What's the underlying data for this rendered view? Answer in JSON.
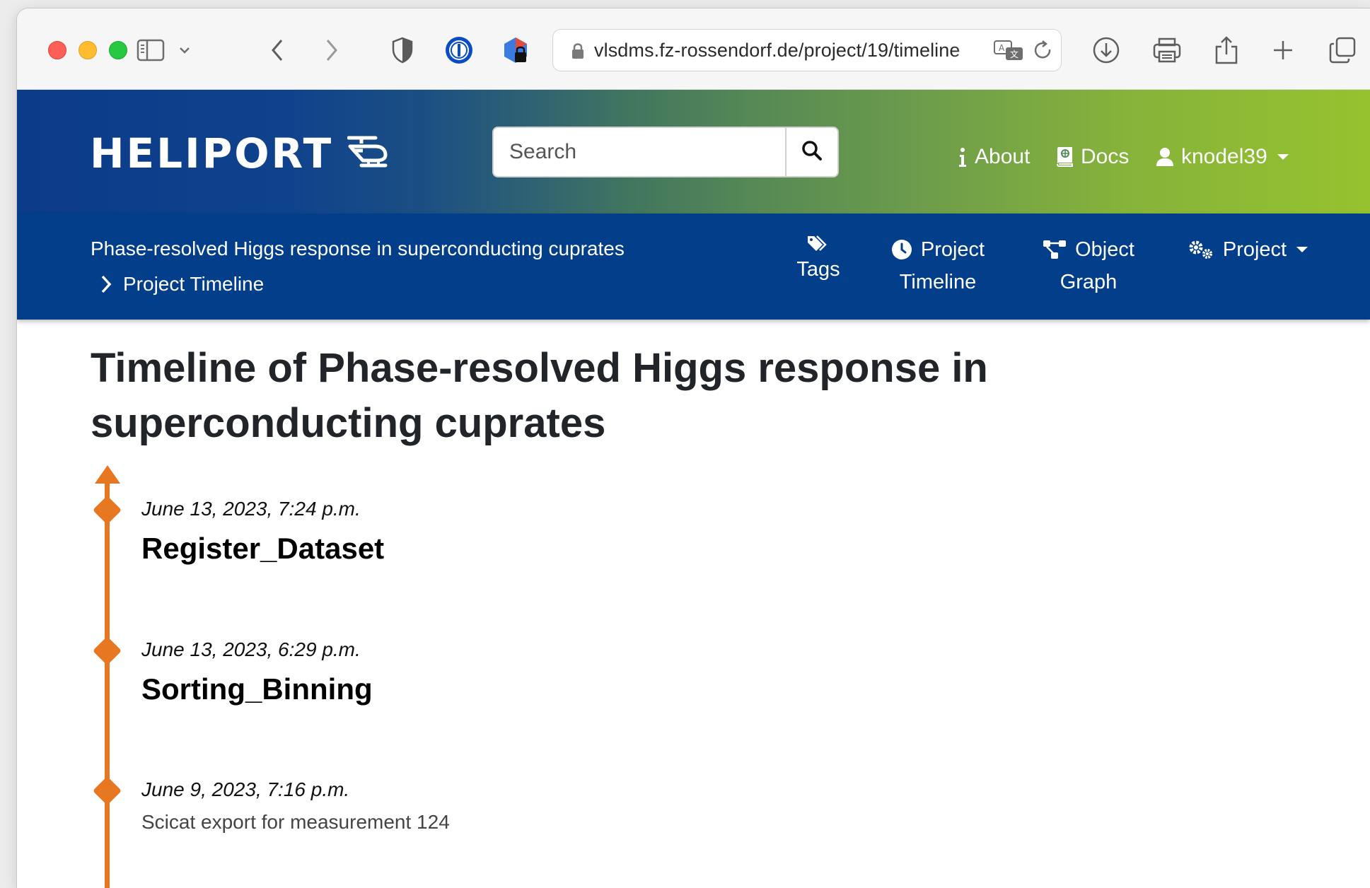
{
  "browser": {
    "url": "vlsdms.fz-rossendorf.de/project/19/timeline"
  },
  "header": {
    "brand": "HELIPORT",
    "search_placeholder": "Search",
    "nav": {
      "about": "About",
      "docs": "Docs",
      "user": "knodel39"
    }
  },
  "subnav": {
    "breadcrumb_project": "Phase-resolved Higgs response in superconducting cuprates",
    "breadcrumb_current": "Project Timeline",
    "items": [
      {
        "line1": "",
        "line2": "Tags"
      },
      {
        "line1": "Project",
        "line2": "Timeline"
      },
      {
        "line1": "Object",
        "line2": "Graph"
      },
      {
        "line1": "Project",
        "line2": ""
      }
    ]
  },
  "main": {
    "title": "Timeline of Phase-resolved Higgs response in superconducting cuprates",
    "events": [
      {
        "date": "June 13, 2023, 7:24 p.m.",
        "title": "Register_Dataset",
        "description": ""
      },
      {
        "date": "June 13, 2023, 6:29 p.m.",
        "title": "Sorting_Binning",
        "description": ""
      },
      {
        "date": "June 9, 2023, 7:16 p.m.",
        "title": "",
        "description": "Scicat export for measurement 124"
      }
    ]
  },
  "colors": {
    "timeline_accent": "#e87722",
    "subnav_bg": "#023e8a"
  }
}
